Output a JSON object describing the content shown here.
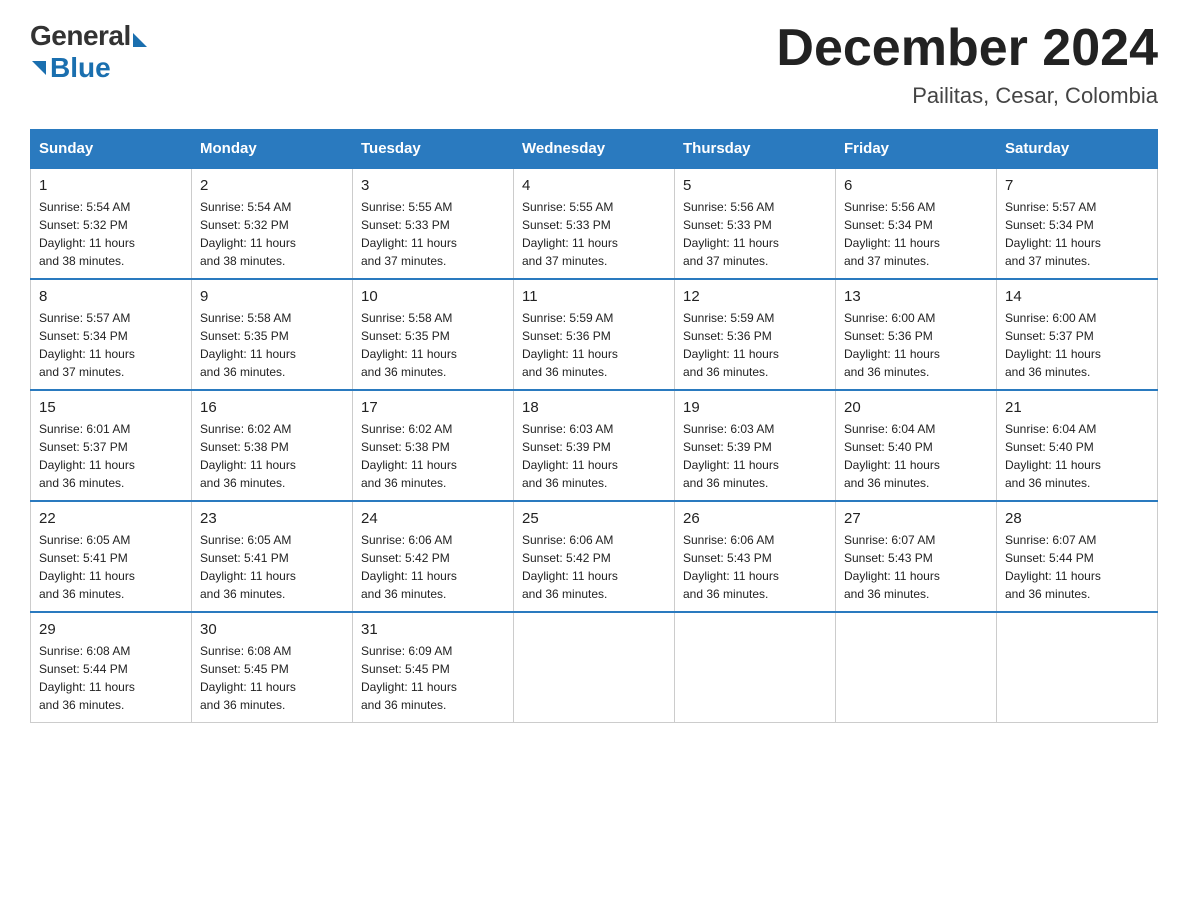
{
  "logo": {
    "general": "General",
    "blue": "Blue"
  },
  "title": {
    "month_year": "December 2024",
    "location": "Pailitas, Cesar, Colombia"
  },
  "headers": [
    "Sunday",
    "Monday",
    "Tuesday",
    "Wednesday",
    "Thursday",
    "Friday",
    "Saturday"
  ],
  "weeks": [
    [
      {
        "day": "1",
        "sunrise": "5:54 AM",
        "sunset": "5:32 PM",
        "daylight": "11 hours and 38 minutes."
      },
      {
        "day": "2",
        "sunrise": "5:54 AM",
        "sunset": "5:32 PM",
        "daylight": "11 hours and 38 minutes."
      },
      {
        "day": "3",
        "sunrise": "5:55 AM",
        "sunset": "5:33 PM",
        "daylight": "11 hours and 37 minutes."
      },
      {
        "day": "4",
        "sunrise": "5:55 AM",
        "sunset": "5:33 PM",
        "daylight": "11 hours and 37 minutes."
      },
      {
        "day": "5",
        "sunrise": "5:56 AM",
        "sunset": "5:33 PM",
        "daylight": "11 hours and 37 minutes."
      },
      {
        "day": "6",
        "sunrise": "5:56 AM",
        "sunset": "5:34 PM",
        "daylight": "11 hours and 37 minutes."
      },
      {
        "day": "7",
        "sunrise": "5:57 AM",
        "sunset": "5:34 PM",
        "daylight": "11 hours and 37 minutes."
      }
    ],
    [
      {
        "day": "8",
        "sunrise": "5:57 AM",
        "sunset": "5:34 PM",
        "daylight": "11 hours and 37 minutes."
      },
      {
        "day": "9",
        "sunrise": "5:58 AM",
        "sunset": "5:35 PM",
        "daylight": "11 hours and 36 minutes."
      },
      {
        "day": "10",
        "sunrise": "5:58 AM",
        "sunset": "5:35 PM",
        "daylight": "11 hours and 36 minutes."
      },
      {
        "day": "11",
        "sunrise": "5:59 AM",
        "sunset": "5:36 PM",
        "daylight": "11 hours and 36 minutes."
      },
      {
        "day": "12",
        "sunrise": "5:59 AM",
        "sunset": "5:36 PM",
        "daylight": "11 hours and 36 minutes."
      },
      {
        "day": "13",
        "sunrise": "6:00 AM",
        "sunset": "5:36 PM",
        "daylight": "11 hours and 36 minutes."
      },
      {
        "day": "14",
        "sunrise": "6:00 AM",
        "sunset": "5:37 PM",
        "daylight": "11 hours and 36 minutes."
      }
    ],
    [
      {
        "day": "15",
        "sunrise": "6:01 AM",
        "sunset": "5:37 PM",
        "daylight": "11 hours and 36 minutes."
      },
      {
        "day": "16",
        "sunrise": "6:02 AM",
        "sunset": "5:38 PM",
        "daylight": "11 hours and 36 minutes."
      },
      {
        "day": "17",
        "sunrise": "6:02 AM",
        "sunset": "5:38 PM",
        "daylight": "11 hours and 36 minutes."
      },
      {
        "day": "18",
        "sunrise": "6:03 AM",
        "sunset": "5:39 PM",
        "daylight": "11 hours and 36 minutes."
      },
      {
        "day": "19",
        "sunrise": "6:03 AM",
        "sunset": "5:39 PM",
        "daylight": "11 hours and 36 minutes."
      },
      {
        "day": "20",
        "sunrise": "6:04 AM",
        "sunset": "5:40 PM",
        "daylight": "11 hours and 36 minutes."
      },
      {
        "day": "21",
        "sunrise": "6:04 AM",
        "sunset": "5:40 PM",
        "daylight": "11 hours and 36 minutes."
      }
    ],
    [
      {
        "day": "22",
        "sunrise": "6:05 AM",
        "sunset": "5:41 PM",
        "daylight": "11 hours and 36 minutes."
      },
      {
        "day": "23",
        "sunrise": "6:05 AM",
        "sunset": "5:41 PM",
        "daylight": "11 hours and 36 minutes."
      },
      {
        "day": "24",
        "sunrise": "6:06 AM",
        "sunset": "5:42 PM",
        "daylight": "11 hours and 36 minutes."
      },
      {
        "day": "25",
        "sunrise": "6:06 AM",
        "sunset": "5:42 PM",
        "daylight": "11 hours and 36 minutes."
      },
      {
        "day": "26",
        "sunrise": "6:06 AM",
        "sunset": "5:43 PM",
        "daylight": "11 hours and 36 minutes."
      },
      {
        "day": "27",
        "sunrise": "6:07 AM",
        "sunset": "5:43 PM",
        "daylight": "11 hours and 36 minutes."
      },
      {
        "day": "28",
        "sunrise": "6:07 AM",
        "sunset": "5:44 PM",
        "daylight": "11 hours and 36 minutes."
      }
    ],
    [
      {
        "day": "29",
        "sunrise": "6:08 AM",
        "sunset": "5:44 PM",
        "daylight": "11 hours and 36 minutes."
      },
      {
        "day": "30",
        "sunrise": "6:08 AM",
        "sunset": "5:45 PM",
        "daylight": "11 hours and 36 minutes."
      },
      {
        "day": "31",
        "sunrise": "6:09 AM",
        "sunset": "5:45 PM",
        "daylight": "11 hours and 36 minutes."
      },
      null,
      null,
      null,
      null
    ]
  ],
  "labels": {
    "sunrise": "Sunrise:",
    "sunset": "Sunset:",
    "daylight": "Daylight:"
  }
}
